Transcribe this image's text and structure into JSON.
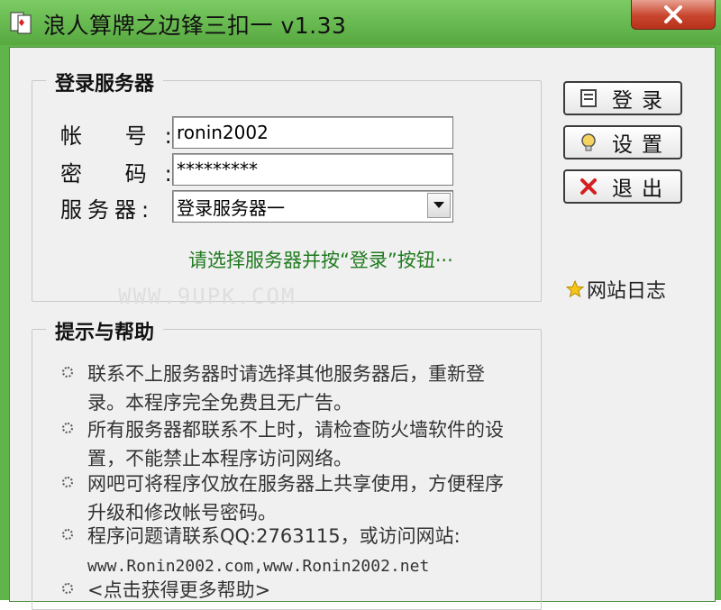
{
  "window": {
    "title": "浪人算牌之边锋三扣一 v1.33"
  },
  "login": {
    "legend": "登录服务器",
    "account_label": "帐 号:",
    "account_value": "ronin2002",
    "password_label": "密 码:",
    "password_value": "*********",
    "server_label": "服务器:",
    "server_value": "登录服务器一",
    "hint": "请选择服务器并按“登录”按钮···"
  },
  "buttons": {
    "login": "登录",
    "settings": "设置",
    "exit": "退出"
  },
  "site_log": "网站日志",
  "watermark": "WWW.9UPK.COM",
  "help": {
    "legend": "提示与帮助",
    "items": [
      {
        "text": "联系不上服务器时请选择其他服务器后，重新登录。本程序完全免费且无广告。"
      },
      {
        "text": "所有服务器都联系不上时，请检查防火墙软件的设置，不能禁止本程序访问网络。"
      },
      {
        "text": "网吧可将程序仅放在服务器上共享使用，方便程序升级和修改帐号密码。"
      },
      {
        "text": "程序问题请联系QQ:2763115，或访问网站:",
        "links": "www.Ronin2002.com,www.Ronin2002.net"
      },
      {
        "text": "<点击获得更多帮助>"
      }
    ]
  },
  "colors": {
    "titlebar": "#5fb44a",
    "hint": "#1f7a1f",
    "close": "#c8452d",
    "exit_icon": "#d42020"
  },
  "icons": [
    "app-icon",
    "close-icon",
    "login-icon",
    "settings-icon",
    "exit-icon",
    "star-icon",
    "bullet-icon"
  ]
}
